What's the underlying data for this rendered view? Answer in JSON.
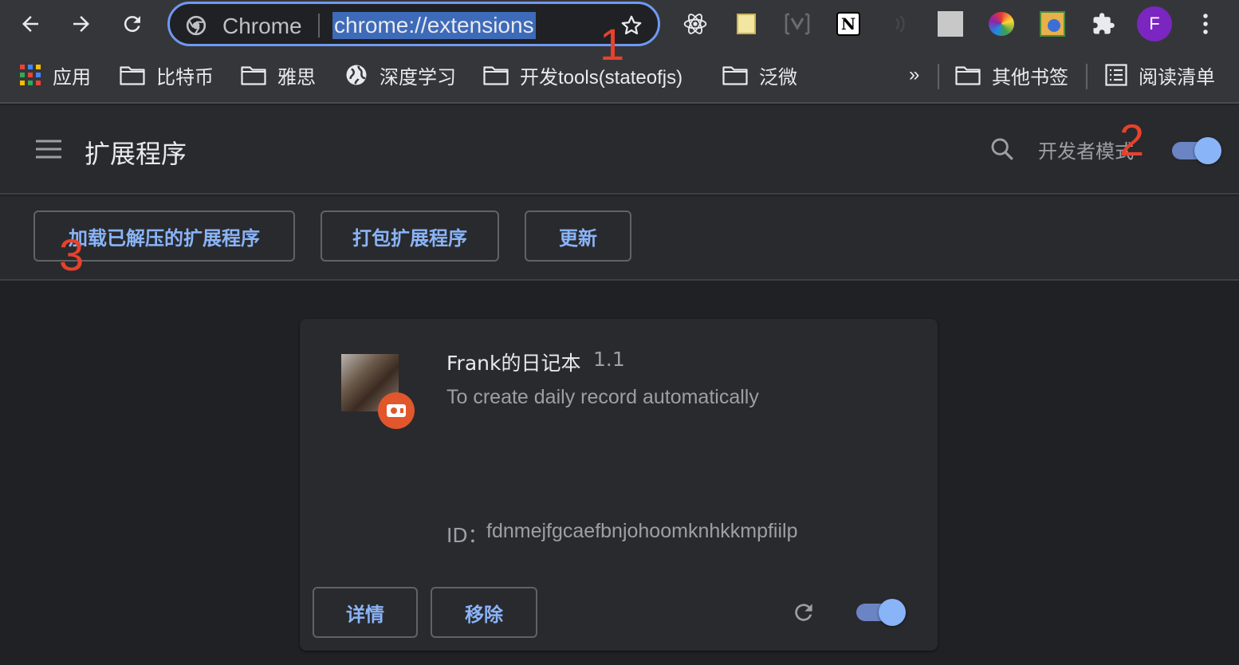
{
  "toolbar": {
    "back_icon": "arrow-left-icon",
    "forward_icon": "arrow-right-icon",
    "reload_icon": "reload-icon",
    "omnibox": {
      "site_label": "Chrome",
      "url": "chrome://extensions"
    },
    "extensions": [
      "react-devtools",
      "notes",
      "vue-ext",
      "notion",
      "ext-gray",
      "ext-blank",
      "ext-color",
      "ext-google",
      "puzzle"
    ],
    "avatar_letter": "F"
  },
  "bookmarks": {
    "items": [
      {
        "label": "应用",
        "icon": "apps-grid-icon"
      },
      {
        "label": "比特币",
        "icon": "folder-icon"
      },
      {
        "label": "雅思",
        "icon": "folder-icon"
      },
      {
        "label": "深度学习",
        "icon": "globe-icon"
      },
      {
        "label": "开发tools(stateofjs)",
        "icon": "folder-icon"
      },
      {
        "label": "泛微",
        "icon": "folder-icon"
      }
    ],
    "overflow": "»",
    "other": "其他书签",
    "reading_list": "阅读清单"
  },
  "header": {
    "title": "扩展程序",
    "dev_mode_label": "开发者模式",
    "dev_mode_on": true
  },
  "dev_bar": {
    "load_unpacked": "加载已解压的扩展程序",
    "pack": "打包扩展程序",
    "update": "更新"
  },
  "extension": {
    "name": "Frank的日记本",
    "version": "1.1",
    "description": "To create daily record automatically",
    "id_label": "ID：",
    "id": "fdnmejfgcaefbnjohoomknhkkmpfiilp",
    "details_button": "详情",
    "remove_button": "移除",
    "enabled": true
  },
  "annotations": [
    "1",
    "2",
    "3"
  ],
  "colors": {
    "accent": "#8ab4f8",
    "annotation": "#e8412c",
    "background": "#202124",
    "surface": "#292a2d"
  }
}
